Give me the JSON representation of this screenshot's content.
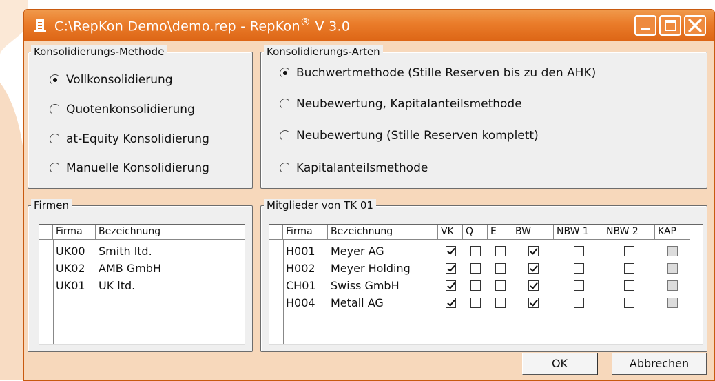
{
  "window": {
    "title_prefix": "C:\\RepKon Demo\\demo.rep - RepKon",
    "title_reg": "®",
    "title_suffix": " V 3.0"
  },
  "methode": {
    "legend": "Konsolidierungs-Methode",
    "options": [
      {
        "label": "Vollkonsolidierung",
        "selected": true
      },
      {
        "label": "Quotenkonsolidierung",
        "selected": false
      },
      {
        "label": "at-Equity Konsolidierung",
        "selected": false
      },
      {
        "label": "Manuelle Konsolidierung",
        "selected": false
      }
    ]
  },
  "arten": {
    "legend": "Konsolidierungs-Arten",
    "options": [
      {
        "label": "Buchwertmethode (Stille Reserven bis zu den AHK)",
        "selected": true
      },
      {
        "label": "Neubewertung, Kapitalanteilsmethode",
        "selected": false
      },
      {
        "label": "Neubewertung (Stille Reserven komplett)",
        "selected": false
      },
      {
        "label": "Kapitalanteilsmethode",
        "selected": false
      }
    ]
  },
  "firmen": {
    "legend": "Firmen",
    "columns": [
      "Firma",
      "Bezeichnung"
    ],
    "rows": [
      [
        "UK00",
        "Smith ltd."
      ],
      [
        "UK02",
        "AMB GmbH"
      ],
      [
        "UK01",
        "UK ltd."
      ]
    ]
  },
  "mitglieder": {
    "legend": "Mitglieder von TK 01",
    "columns": [
      "Firma",
      "Bezeichnung",
      "VK",
      "Q",
      "E",
      "BW",
      "NBW 1",
      "NBW  2",
      "KAP"
    ],
    "rows": [
      {
        "firma": "H001",
        "bez": "Meyer AG",
        "vk": true,
        "q": false,
        "e": false,
        "bw": true,
        "nbw1": false,
        "nbw2": false,
        "kap": false
      },
      {
        "firma": "H002",
        "bez": "Meyer Holding",
        "vk": true,
        "q": false,
        "e": false,
        "bw": true,
        "nbw1": false,
        "nbw2": false,
        "kap": false
      },
      {
        "firma": "CH01",
        "bez": "Swiss GmbH",
        "vk": true,
        "q": false,
        "e": false,
        "bw": true,
        "nbw1": false,
        "nbw2": false,
        "kap": false
      },
      {
        "firma": "H004",
        "bez": "Metall AG",
        "vk": true,
        "q": false,
        "e": false,
        "bw": true,
        "nbw1": false,
        "nbw2": false,
        "kap": false
      }
    ]
  },
  "buttons": {
    "ok": "OK",
    "cancel": "Abbrechen"
  },
  "colors": {
    "title_orange": "#e8782a",
    "client_peach": "#f7d8bb",
    "panel_gray": "#efefef"
  }
}
